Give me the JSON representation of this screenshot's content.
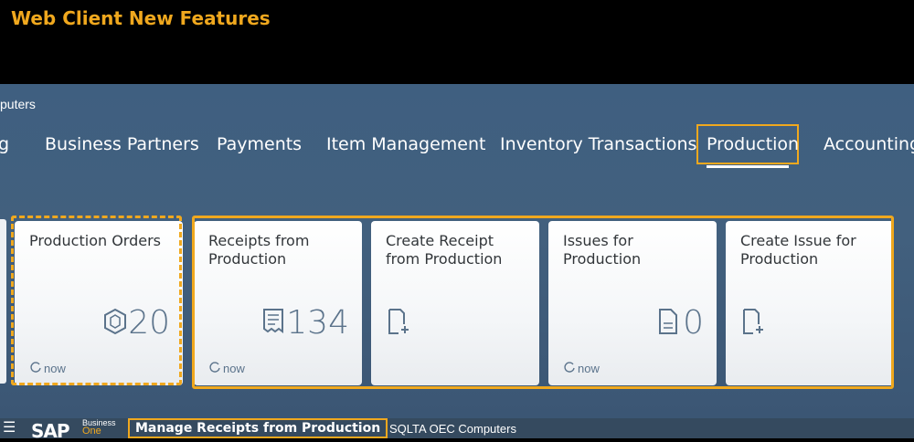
{
  "banner": {
    "title": "Web Client New Features"
  },
  "header": {
    "company": "puters"
  },
  "nav": {
    "items": [
      {
        "label": "g"
      },
      {
        "label": "Business Partners"
      },
      {
        "label": "Payments"
      },
      {
        "label": "Item Management"
      },
      {
        "label": "Inventory Transactions"
      },
      {
        "label": "Production"
      },
      {
        "label": "Accounting"
      }
    ],
    "active": "Production"
  },
  "tiles": [
    {
      "title": "Production Orders",
      "count": "20",
      "icon": "box-icon",
      "footer": "now"
    },
    {
      "title": "Receipts from Production",
      "count": "134",
      "icon": "receipt-icon",
      "footer": "now"
    },
    {
      "title": "Create Receipt from Production",
      "count": "",
      "icon": "add-document-icon",
      "footer": ""
    },
    {
      "title": "Issues for Production",
      "count": "0",
      "icon": "document-icon",
      "footer": "now"
    },
    {
      "title": "Create Issue for Production",
      "count": "",
      "icon": "add-document-icon",
      "footer": ""
    }
  ],
  "bottom_bar": {
    "logo": "SAP",
    "logo_sub_1": "Business",
    "logo_sub_2": "One",
    "app_title": "Manage Receipts from Production",
    "database": "SQLTA OEC Computers"
  },
  "colors": {
    "accent": "#f0a81e",
    "shell": "#42607e",
    "bar": "#354a5f"
  }
}
